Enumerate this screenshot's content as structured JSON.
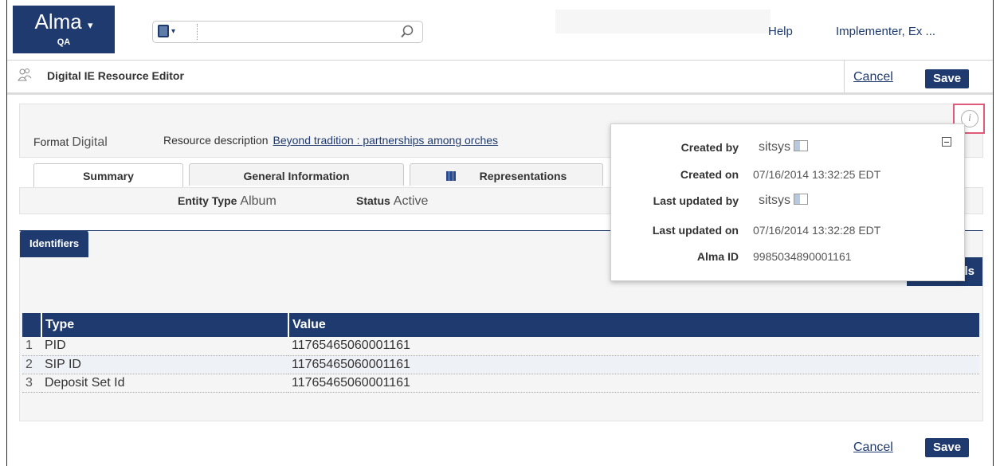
{
  "header": {
    "logo_text": "Alma",
    "environment": "QA",
    "search": {
      "value": "",
      "placeholder": ""
    },
    "help_label": "Help",
    "user_label": "Implementer, Ex ..."
  },
  "editor": {
    "title": "Digital IE Resource Editor",
    "cancel_label": "Cancel",
    "save_label": "Save"
  },
  "resource": {
    "format_label": "Format",
    "format_value": "Digital",
    "description_label": "Resource description",
    "description_value": "Beyond tradition : partnerships among orches"
  },
  "tabs": [
    {
      "label": "Summary",
      "active": true
    },
    {
      "label": "General Information",
      "active": false
    },
    {
      "label": "Representations",
      "active": false,
      "icon": "grid-icon"
    }
  ],
  "summary": {
    "entity_type_label": "Entity Type",
    "entity_type_value": "Album",
    "status_label": "Status",
    "status_value": "Active"
  },
  "identifiers": {
    "section_title": "Identifiers",
    "tools_label": "Tools",
    "columns": [
      "Type",
      "Value"
    ],
    "rows": [
      {
        "num": "1",
        "type": "PID",
        "value": "11765465060001161"
      },
      {
        "num": "2",
        "type": "SIP ID",
        "value": "11765465060001161"
      },
      {
        "num": "3",
        "type": "Deposit Set Id",
        "value": "11765465060001161"
      }
    ]
  },
  "info_popup": {
    "created_by_label": "Created by",
    "created_by_value": "sitsys",
    "created_on_label": "Created on",
    "created_on_value": "07/16/2014 13:32:25 EDT",
    "last_updated_by_label": "Last updated by",
    "last_updated_by_value": "sitsys",
    "last_updated_on_label": "Last updated on",
    "last_updated_on_value": "07/16/2014 13:32:28 EDT",
    "alma_id_label": "Alma ID",
    "alma_id_value": "9985034890001161"
  },
  "colors": {
    "brand_navy": "#1e3a6e",
    "highlight_pink": "#e05a7a"
  }
}
